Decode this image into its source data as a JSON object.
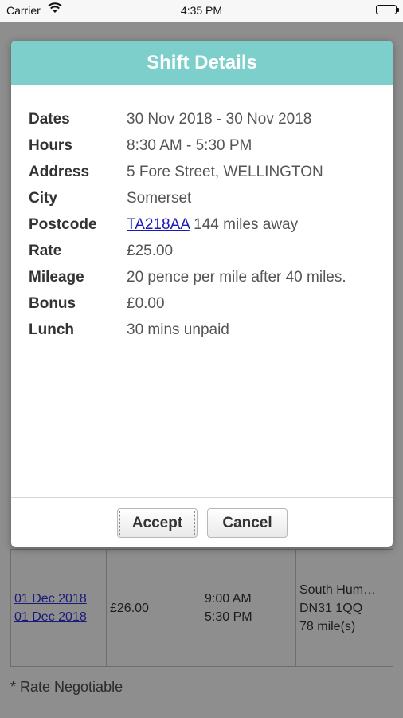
{
  "status_bar": {
    "carrier": "Carrier",
    "time": "4:35 PM"
  },
  "dialog": {
    "title": "Shift Details",
    "rows": [
      {
        "label": "Dates",
        "value": "30 Nov 2018 - 30 Nov 2018"
      },
      {
        "label": "Hours",
        "value": "8:30 AM - 5:30 PM"
      },
      {
        "label": "Address",
        "value": "5 Fore Street, WELLINGTON"
      },
      {
        "label": "City",
        "value": "Somerset"
      },
      {
        "label": "Postcode",
        "link": "TA218AA",
        "value": " 144 miles away"
      },
      {
        "label": "Rate",
        "value": "£25.00"
      },
      {
        "label": "Mileage",
        "value": "20 pence per mile after 40 miles."
      },
      {
        "label": "Bonus",
        "value": "£0.00"
      },
      {
        "label": "Lunch",
        "value": "30 mins unpaid"
      }
    ],
    "accept_label": "Accept",
    "cancel_label": "Cancel"
  },
  "background": {
    "row": {
      "date_start": "01 Dec 2018",
      "date_end": "01 Dec 2018",
      "rate": "£26.00",
      "time_start": "9:00 AM",
      "time_end": "5:30 PM",
      "location": "South Hum…",
      "postcode": "DN31 1QQ",
      "distance": "78 mile(s)"
    },
    "note": "* Rate Negotiable"
  },
  "colors": {
    "header": "#7ccfcb",
    "link": "#1a1ab5"
  }
}
